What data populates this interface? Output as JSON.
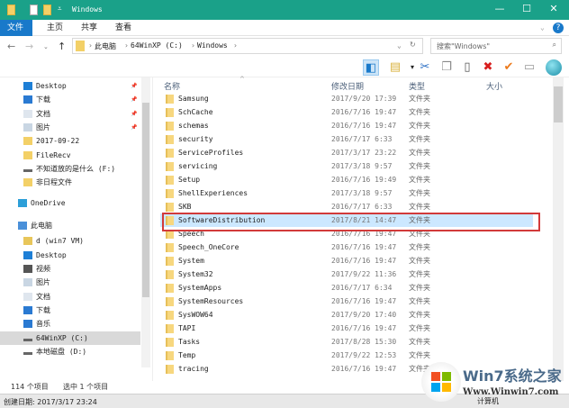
{
  "window": {
    "title": "Windows",
    "minimize": "—",
    "maximize": "☐",
    "close": "✕"
  },
  "ribbon": {
    "tabs": [
      "文件",
      "主页",
      "共享",
      "查看"
    ],
    "accent": "#1979ca"
  },
  "address": {
    "segments": [
      "此电脑",
      "64WinXP  (C:)",
      "Windows"
    ],
    "search_placeholder": "搜索\"Windows\""
  },
  "sidebar": {
    "items": [
      {
        "label": "Desktop",
        "icon": "desktop-icon",
        "pinned": true
      },
      {
        "label": "下载",
        "icon": "download-icon",
        "pinned": true
      },
      {
        "label": "文档",
        "icon": "document-icon",
        "pinned": true
      },
      {
        "label": "图片",
        "icon": "picture-icon",
        "pinned": true
      },
      {
        "label": "2017-09-22",
        "icon": "folder-icon"
      },
      {
        "label": "FileRecv",
        "icon": "folder-icon"
      },
      {
        "label": "不知道放的是什么 (F:)",
        "icon": "drive-icon"
      },
      {
        "label": "非日程文件",
        "icon": "folder-icon"
      },
      {
        "label": "OneDrive",
        "icon": "onedrive-icon",
        "level": 0,
        "gap": true
      },
      {
        "label": "此电脑",
        "icon": "computer-icon",
        "level": 0,
        "gap": true
      },
      {
        "label": "d (win7 VM)",
        "icon": "network-drive-icon"
      },
      {
        "label": "Desktop",
        "icon": "desktop-icon"
      },
      {
        "label": "视频",
        "icon": "video-icon"
      },
      {
        "label": "图片",
        "icon": "picture-icon"
      },
      {
        "label": "文档",
        "icon": "document-icon"
      },
      {
        "label": "下载",
        "icon": "download-icon"
      },
      {
        "label": "音乐",
        "icon": "music-icon"
      },
      {
        "label": "64WinXP  (C:)",
        "icon": "drive-icon",
        "selected": true
      },
      {
        "label": "本地磁盘 (D:)",
        "icon": "drive-icon"
      }
    ]
  },
  "columns": {
    "name": "名称",
    "date": "修改日期",
    "type": "类型",
    "size": "大小"
  },
  "files": [
    {
      "name": "Samsung",
      "date": "2017/9/20 17:39",
      "type": "文件夹"
    },
    {
      "name": "SchCache",
      "date": "2016/7/16 19:47",
      "type": "文件夹"
    },
    {
      "name": "schemas",
      "date": "2016/7/16 19:47",
      "type": "文件夹"
    },
    {
      "name": "security",
      "date": "2016/7/17 6:33",
      "type": "文件夹"
    },
    {
      "name": "ServiceProfiles",
      "date": "2017/3/17 23:22",
      "type": "文件夹"
    },
    {
      "name": "servicing",
      "date": "2017/3/18 9:57",
      "type": "文件夹"
    },
    {
      "name": "Setup",
      "date": "2016/7/16 19:49",
      "type": "文件夹"
    },
    {
      "name": "ShellExperiences",
      "date": "2017/3/18 9:57",
      "type": "文件夹"
    },
    {
      "name": "SKB",
      "date": "2016/7/17 6:33",
      "type": "文件夹"
    },
    {
      "name": "SoftwareDistribution",
      "date": "2017/8/21 14:47",
      "type": "文件夹",
      "selected": true
    },
    {
      "name": "Speech",
      "date": "2016/7/16 19:47",
      "type": "文件夹"
    },
    {
      "name": "Speech_OneCore",
      "date": "2016/7/16 19:47",
      "type": "文件夹"
    },
    {
      "name": "System",
      "date": "2016/7/16 19:47",
      "type": "文件夹"
    },
    {
      "name": "System32",
      "date": "2017/9/22 11:36",
      "type": "文件夹"
    },
    {
      "name": "SystemApps",
      "date": "2016/7/17 6:34",
      "type": "文件夹"
    },
    {
      "name": "SystemResources",
      "date": "2016/7/16 19:47",
      "type": "文件夹"
    },
    {
      "name": "SysWOW64",
      "date": "2017/9/20 17:40",
      "type": "文件夹"
    },
    {
      "name": "TAPI",
      "date": "2016/7/16 19:47",
      "type": "文件夹"
    },
    {
      "name": "Tasks",
      "date": "2017/8/28 15:30",
      "type": "文件夹"
    },
    {
      "name": "Temp",
      "date": "2017/9/22 12:53",
      "type": "文件夹"
    },
    {
      "name": "tracing",
      "date": "2016/7/16 19:47",
      "type": "文件夹"
    }
  ],
  "status": {
    "count": "114 个项目",
    "selected": "选中 1 个项目",
    "created": "创建日期: 2017/3/17 23:24",
    "taskbar_item": "计算机"
  },
  "watermark": {
    "text": "Win7系统之家",
    "url": "Www.Winwin7.com"
  }
}
